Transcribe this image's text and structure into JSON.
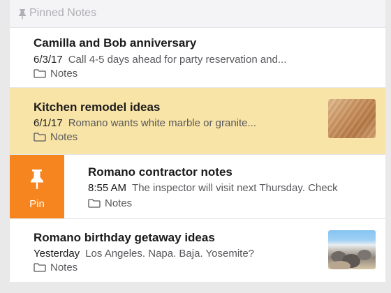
{
  "section": {
    "title": "Pinned Notes",
    "icon": "pin-icon"
  },
  "notes": [
    {
      "title": "Camilla and Bob anniversary",
      "date": "6/3/17",
      "preview": "Call 4-5 days ahead for party reservation and...",
      "folder": "Notes",
      "selected": false
    },
    {
      "title": "Kitchen remodel ideas",
      "date": "6/1/17",
      "preview": "Romano wants white marble or granite...",
      "folder": "Notes",
      "selected": true,
      "thumbnail": "wood-texture"
    },
    {
      "title": "Romano contractor notes",
      "date": "8:55 AM",
      "preview": "The inspector will visit next Thursday. Check",
      "folder": "Notes",
      "swiped": true
    },
    {
      "title": "Romano birthday getaway ideas",
      "date": "Yesterday",
      "preview": "Los Angeles. Napa. Baja. Yosemite?",
      "folder": "Notes",
      "thumbnail": "beach-rocks"
    }
  ],
  "swipe_action": {
    "label": "Pin",
    "icon": "pin-icon",
    "color": "#f6841f"
  },
  "colors": {
    "selected_row": "#f8e4a7",
    "header_text": "#b0b0b4",
    "accent": "#f6841f"
  }
}
